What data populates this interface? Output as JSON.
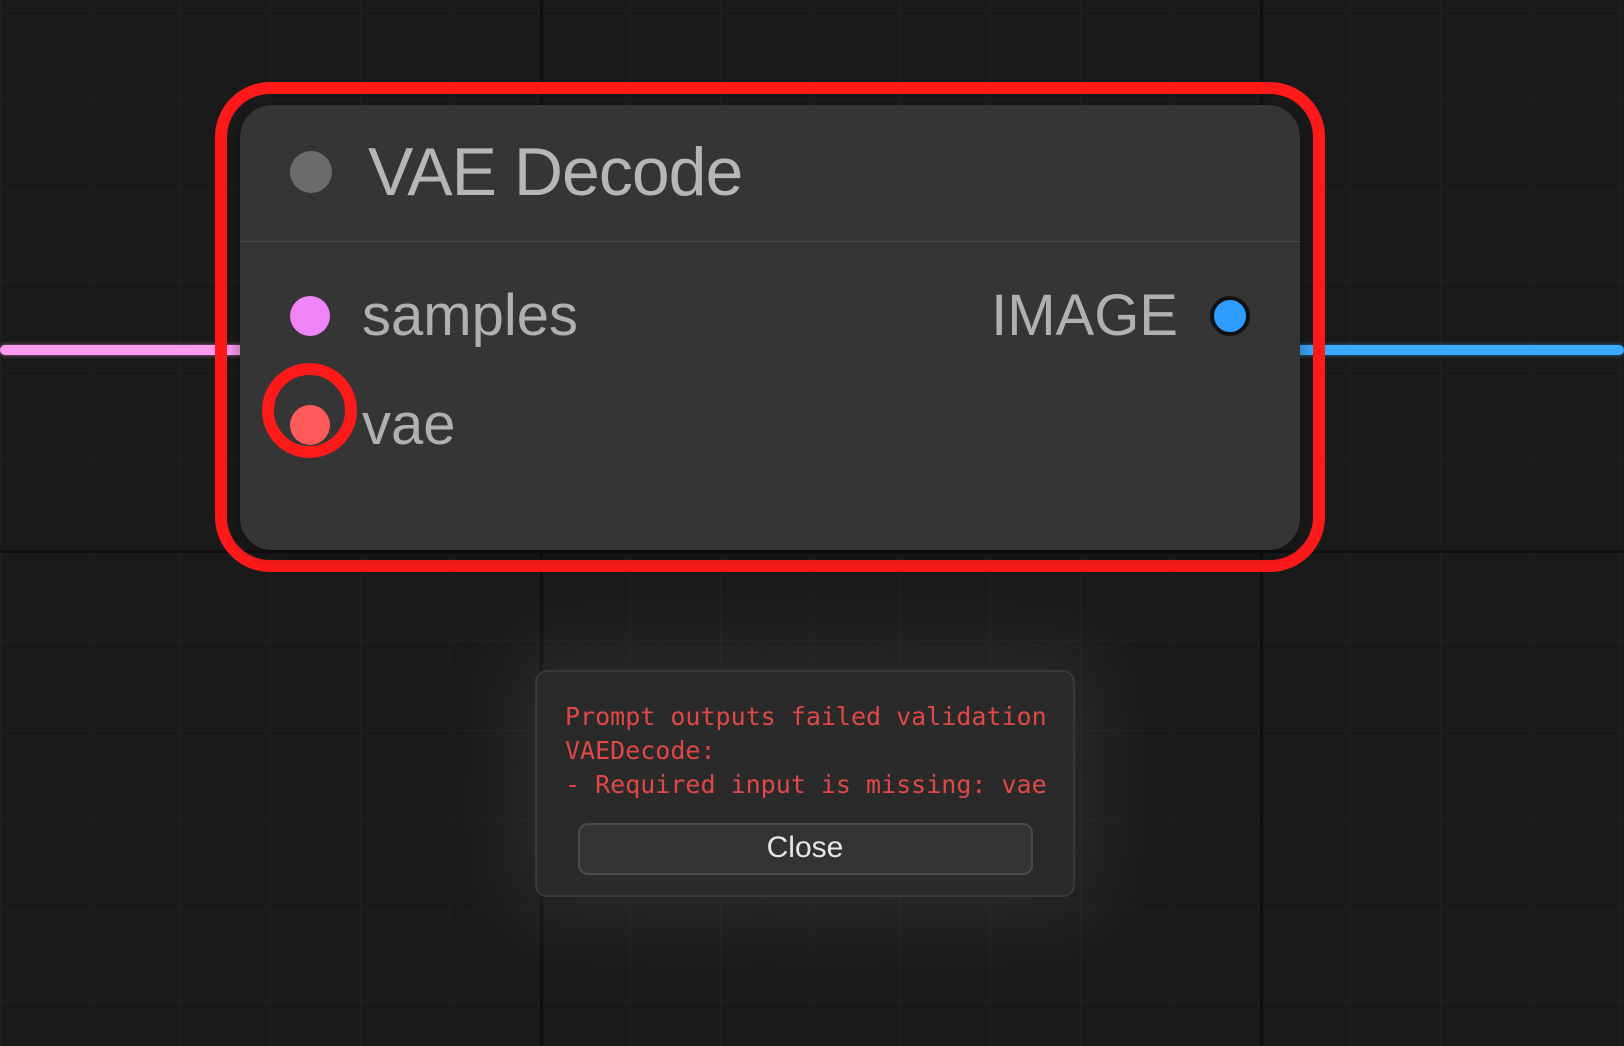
{
  "node": {
    "title": "VAE Decode",
    "inputs": [
      {
        "name": "samples",
        "color": "#f084f7",
        "connected": true,
        "error": false
      },
      {
        "name": "vae",
        "color": "#ff5a5a",
        "connected": false,
        "error": true
      }
    ],
    "outputs": [
      {
        "name": "IMAGE",
        "color": "#2d9dff",
        "connected": true
      }
    ],
    "has_error": true
  },
  "dialog": {
    "lines": [
      "Prompt outputs failed validation",
      "VAEDecode:",
      "- Required input is missing: vae"
    ],
    "close_label": "Close"
  },
  "colors": {
    "error": "#ff1a1a",
    "cable_pink": "#ff9cf2",
    "cable_blue": "#3aaaff"
  }
}
